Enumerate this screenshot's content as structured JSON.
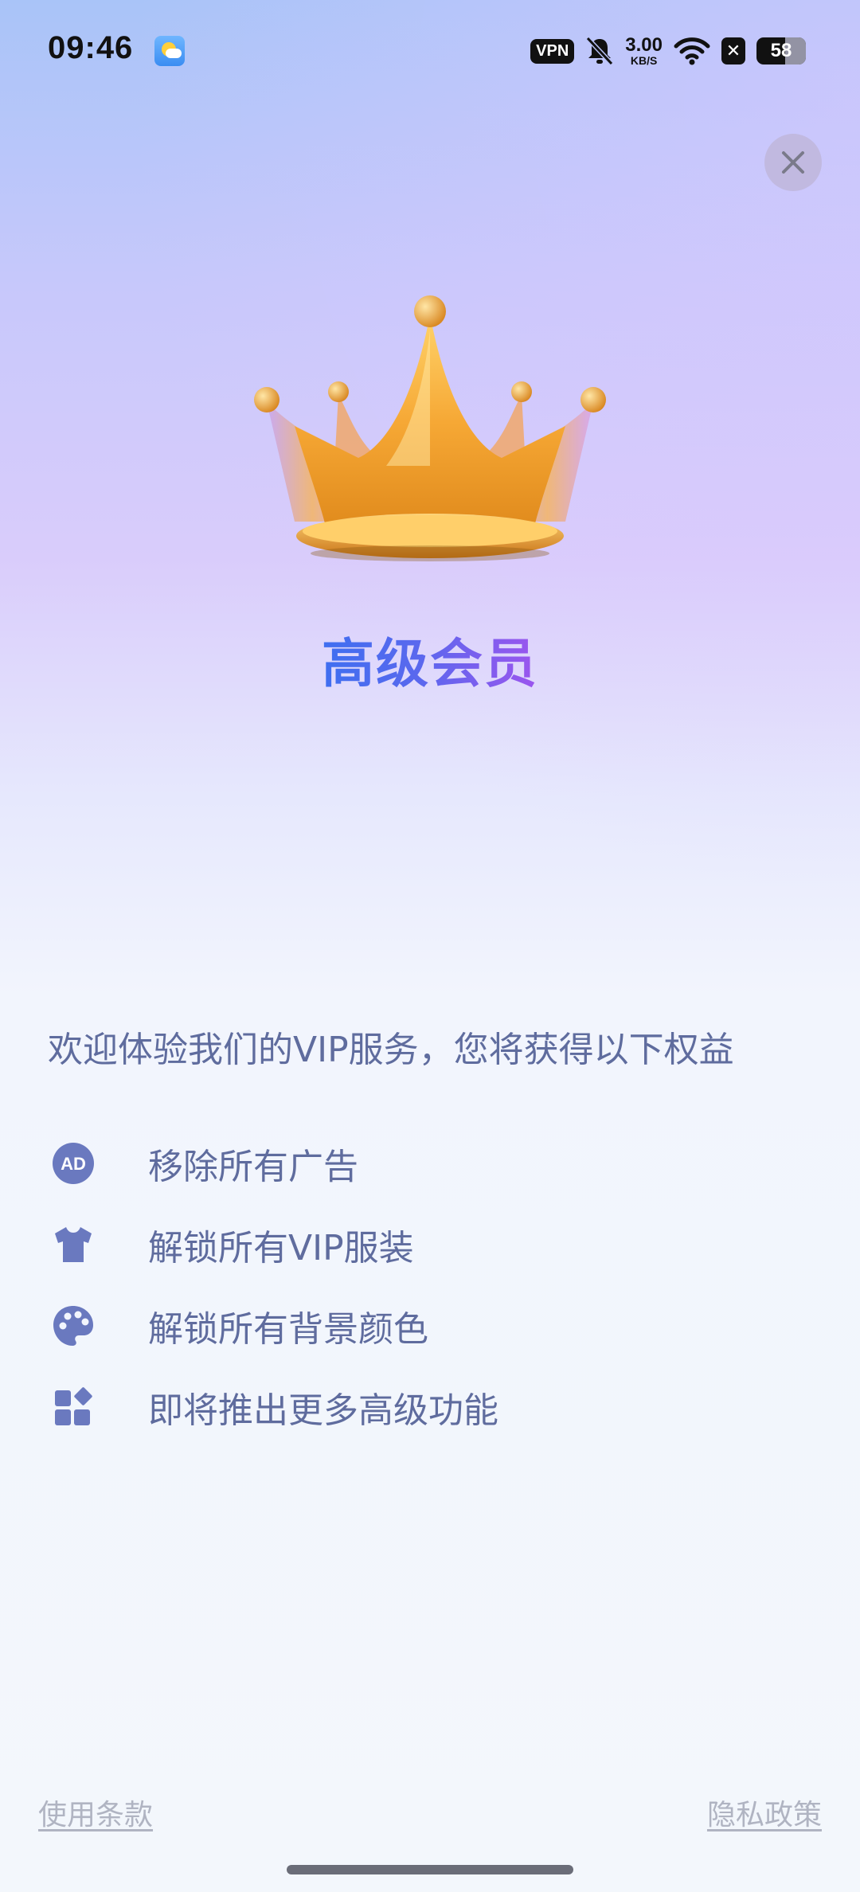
{
  "status_bar": {
    "time": "09:46",
    "vpn": "VPN",
    "net_speed_value": "3.00",
    "net_speed_unit": "KB/S",
    "x_badge": "✕",
    "battery": "58"
  },
  "header": {
    "title": "高级会员"
  },
  "main": {
    "intro": "欢迎体验我们的VIP服务，您将获得以下权益",
    "benefits": [
      {
        "icon": "ad-icon",
        "label": "移除所有广告"
      },
      {
        "icon": "shirt-icon",
        "label": "解锁所有VIP服装"
      },
      {
        "icon": "palette-icon",
        "label": "解锁所有背景颜色"
      },
      {
        "icon": "widgets-icon",
        "label": "即将推出更多高级功能"
      }
    ]
  },
  "footer": {
    "terms": "使用条款",
    "privacy": "隐私政策"
  },
  "colors": {
    "accent_blue": "#3f6ff0",
    "accent_purple": "#9c55ee",
    "benefit_icon": "#6a79bf",
    "text": "#5f6c9e"
  }
}
